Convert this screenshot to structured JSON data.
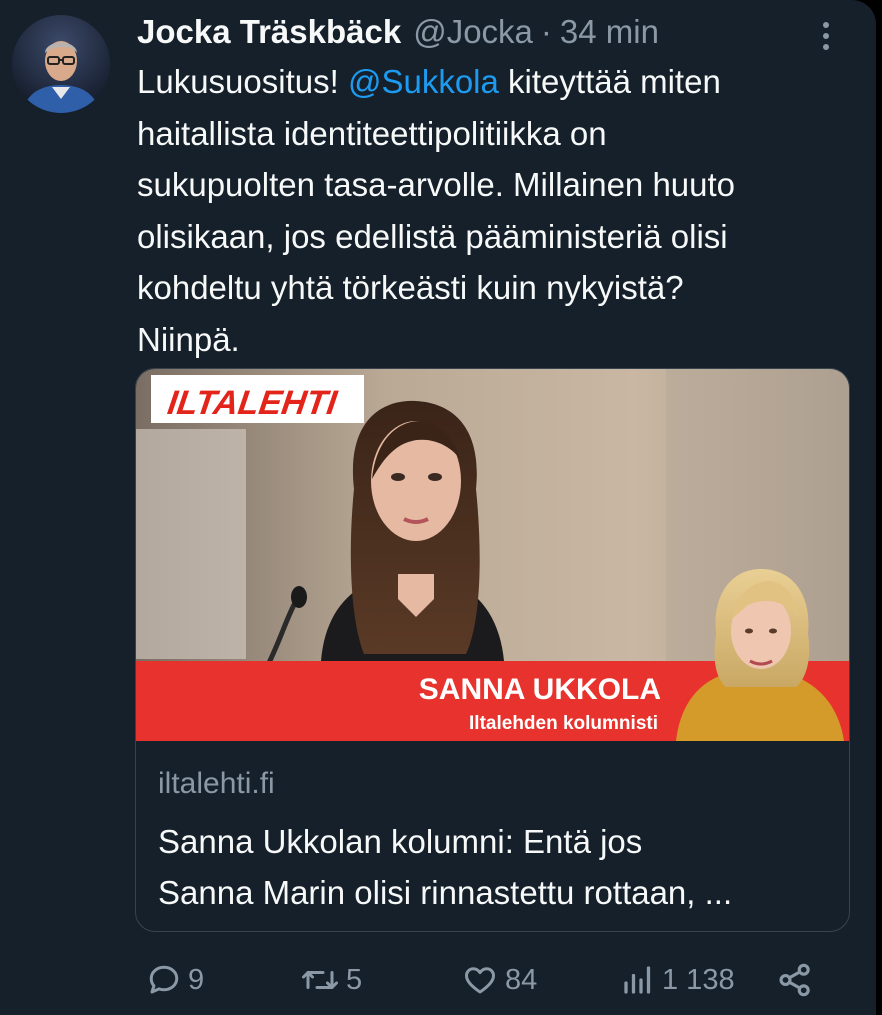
{
  "tweet": {
    "author_name": "Jocka Träskbäck",
    "handle": "@Jocka",
    "separator": "·",
    "time": "34 min",
    "text_lines": [
      {
        "pre": "Lukusuositus! ",
        "mention": "@Sukkola",
        "post": " kiteyttää miten"
      },
      {
        "text": "haitallista identiteettipolitiikka on"
      },
      {
        "text": "sukupuolten tasa-arvolle. Millainen huuto"
      },
      {
        "text": "olisikaan, jos edellistä pääministeriä olisi"
      },
      {
        "text": "kohdeltu yhtä törkeästi kuin nykyistä?"
      },
      {
        "text": "Niinpä."
      }
    ]
  },
  "link_card": {
    "image": {
      "logo_text": "ILTALEHTI",
      "banner_name": "SANNA UKKOLA",
      "banner_role": "Iltalehden kolumnisti"
    },
    "domain": "iltalehti.fi",
    "title_lines": [
      "Sanna Ukkolan kolumni: Entä jos",
      "Sanna Marin olisi rinnastettu rottaan, ..."
    ]
  },
  "actions": {
    "replies": "9",
    "retweets": "5",
    "likes": "84",
    "views": "1 138"
  },
  "colors": {
    "background": "#15202b",
    "text_primary": "#f7f9f9",
    "text_secondary": "#8b98a5",
    "accent": "#1d9bf0",
    "brand_red": "#e8322d"
  },
  "icons": [
    "more-icon",
    "reply-icon",
    "retweet-icon",
    "like-icon",
    "views-icon",
    "share-icon"
  ]
}
